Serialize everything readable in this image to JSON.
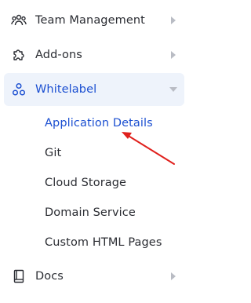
{
  "sidebar": {
    "items": [
      {
        "label": "Team Management",
        "icon": "team-icon"
      },
      {
        "label": "Add-ons",
        "icon": "puzzle-icon"
      },
      {
        "label": "Whitelabel",
        "icon": "whitelabel-icon",
        "expanded": true
      },
      {
        "label": "Docs",
        "icon": "book-icon"
      }
    ],
    "subitems": [
      {
        "label": "Application Details",
        "active": true
      },
      {
        "label": "Git"
      },
      {
        "label": "Cloud Storage"
      },
      {
        "label": "Domain Service"
      },
      {
        "label": "Custom HTML Pages"
      }
    ]
  },
  "colors": {
    "accent": "#1b4fd1",
    "active_bg": "#eef3fb",
    "text": "#2b2d33",
    "chevron": "#b9bcc4",
    "annotation_arrow": "#e0201c"
  }
}
